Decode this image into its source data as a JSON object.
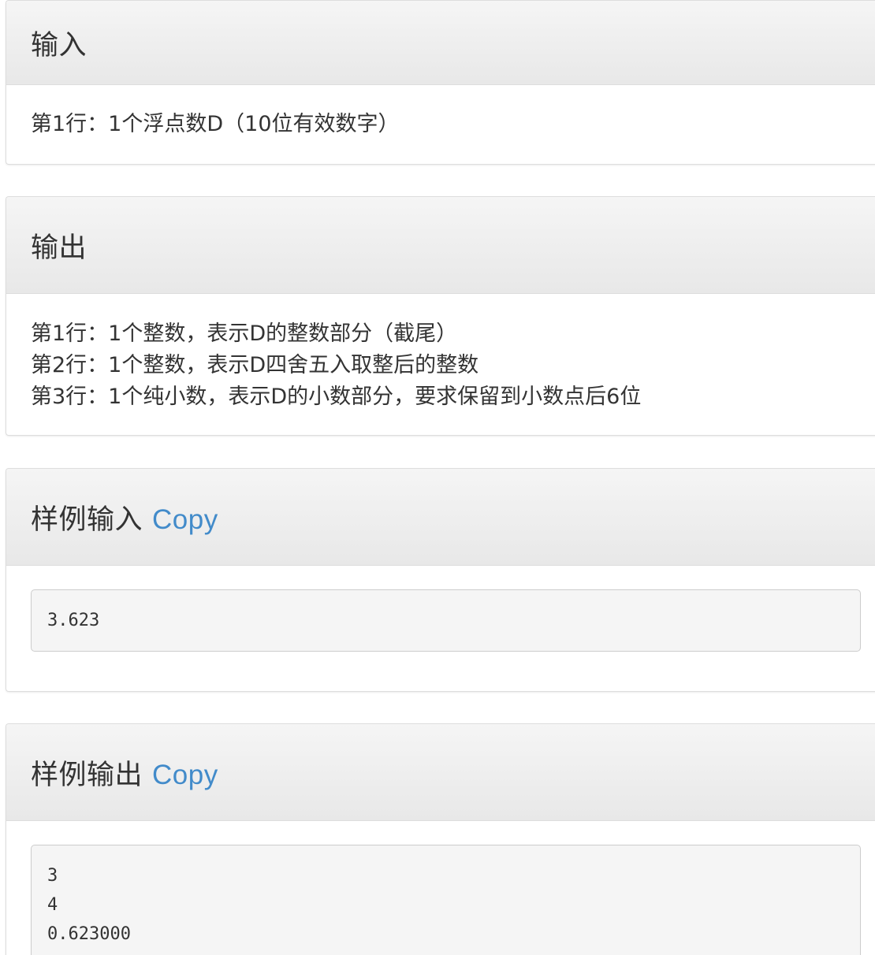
{
  "sections": {
    "input": {
      "title": "输入",
      "lines": [
        "第1行：1个浮点数D（10位有效数字）"
      ]
    },
    "output": {
      "title": "输出",
      "lines": [
        "第1行：1个整数，表示D的整数部分（截尾）",
        "第2行：1个整数，表示D四舍五入取整后的整数",
        "第3行：1个纯小数，表示D的小数部分，要求保留到小数点后6位"
      ]
    },
    "sample_input": {
      "title": "样例输入",
      "copy_label": "Copy",
      "lines": [
        "3.623"
      ]
    },
    "sample_output": {
      "title": "样例输出",
      "copy_label": "Copy",
      "lines": [
        "3",
        "4",
        "0.623000"
      ]
    }
  },
  "colors": {
    "link": "#428bca",
    "heading_bg": "#eeeeee",
    "code_bg": "#f5f5f5",
    "border": "#dddddd"
  }
}
